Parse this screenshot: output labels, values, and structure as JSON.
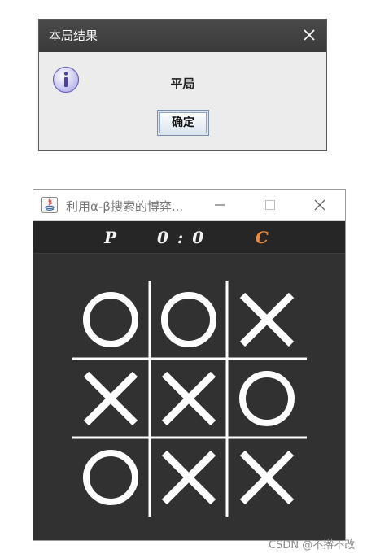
{
  "dialog": {
    "title": "本局结果",
    "message": "平局",
    "ok_label": "确定",
    "icon": "info-icon"
  },
  "game": {
    "title": "利用α-β搜索的博弈...",
    "score": {
      "player": "P",
      "value": "0 : 0",
      "computer": "C"
    },
    "board": [
      [
        "O",
        "O",
        "X"
      ],
      [
        "X",
        "X",
        "O"
      ],
      [
        "O",
        "X",
        "X"
      ]
    ]
  },
  "watermark": "CSDN @不擀不改",
  "colors": {
    "board_background": "#313131",
    "mark": "#ffffff",
    "computer_score": "#ef8a3c"
  }
}
